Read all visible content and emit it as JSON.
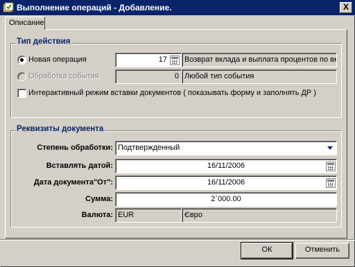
{
  "window": {
    "title": "Выполнение операций - Добавление.",
    "close_label": "X"
  },
  "tabs": [
    {
      "label": "Описание"
    }
  ],
  "action_group": {
    "legend": "Тип действия",
    "new_op": {
      "label": "Новая операция",
      "selected": true,
      "code": "17",
      "description": "Возврат вклада и выплата процентов по вк"
    },
    "event": {
      "label": "Обработка события",
      "selected": false,
      "disabled": true,
      "code": "0",
      "description": "Любой тип события"
    },
    "interactive": {
      "label": "Интерактивный режим вставки документов ( показывать форму и заполнять ДР )",
      "checked": false
    }
  },
  "doc_group": {
    "legend": "Реквизиты документа",
    "status": {
      "label": "Степень обработки:",
      "value": "Подтвержденный"
    },
    "insert_date": {
      "label": "Вставлять датой:",
      "value": "16/11/2006"
    },
    "doc_date": {
      "label": "Дата документа\"От\":",
      "value": "16/11/2006"
    },
    "amount": {
      "label": "Сумма:",
      "value": "2`000.00"
    },
    "currency": {
      "label": "Валюта:",
      "code": "EUR",
      "name": "Євро"
    }
  },
  "buttons": {
    "ok": "ОК",
    "cancel": "Отменить"
  },
  "colors": {
    "title_bar": "#0a246a",
    "face": "#d4d0c8",
    "legend_text": "#0a246a"
  }
}
